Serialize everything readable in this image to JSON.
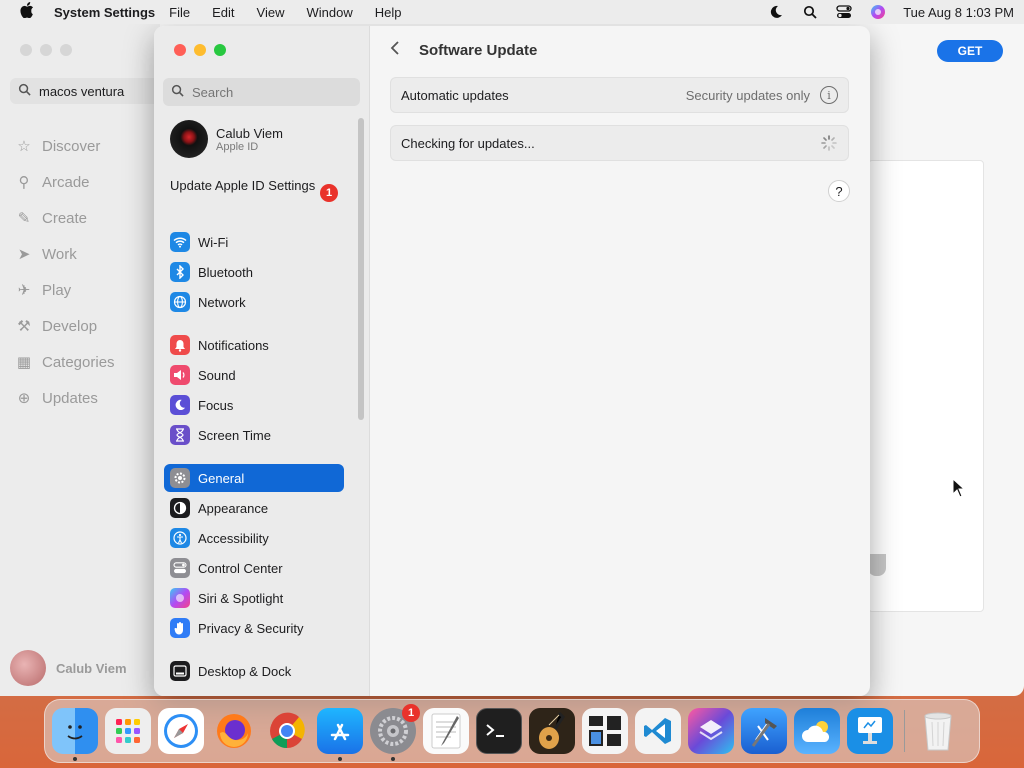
{
  "menubar": {
    "app_name": "System Settings",
    "items": [
      "File",
      "Edit",
      "View",
      "Window",
      "Help"
    ],
    "clock": "Tue Aug 8  1:03 PM"
  },
  "app_store": {
    "search_value": "macos ventura",
    "nav": [
      {
        "label": "Discover",
        "icon": "star-icon"
      },
      {
        "label": "Arcade",
        "icon": "arcade-icon"
      },
      {
        "label": "Create",
        "icon": "brush-icon"
      },
      {
        "label": "Work",
        "icon": "paperplane-icon"
      },
      {
        "label": "Play",
        "icon": "rocket-icon"
      },
      {
        "label": "Develop",
        "icon": "hammer-icon"
      },
      {
        "label": "Categories",
        "icon": "grid-icon"
      },
      {
        "label": "Updates",
        "icon": "download-icon"
      }
    ],
    "user": "Calub Viem",
    "get_label": "GET"
  },
  "settings": {
    "search_placeholder": "Search",
    "profile": {
      "name": "Calub Viem",
      "sub": "Apple ID"
    },
    "update_apple_id": "Update Apple ID Settings",
    "update_badge": "1",
    "items": [
      {
        "label": "Wi-Fi",
        "color": "#1e88e5",
        "glyph": "📶"
      },
      {
        "label": "Bluetooth",
        "color": "#1e88e5",
        "glyph": "ᛒ"
      },
      {
        "label": "Network",
        "color": "#1e88e5",
        "glyph": "🌐"
      },
      {
        "label": "Notifications",
        "color": "#ef4b4b",
        "glyph": "🔔"
      },
      {
        "label": "Sound",
        "color": "#ef4b6e",
        "glyph": "🔊"
      },
      {
        "label": "Focus",
        "color": "#5b4fd6",
        "glyph": "☾"
      },
      {
        "label": "Screen Time",
        "color": "#6a4fc9",
        "glyph": "⌛"
      },
      {
        "label": "General",
        "color": "#8e8e93",
        "glyph": "⚙"
      },
      {
        "label": "Appearance",
        "color": "#1c1c1e",
        "glyph": "◐"
      },
      {
        "label": "Accessibility",
        "color": "#1e88e5",
        "glyph": "♿"
      },
      {
        "label": "Control Center",
        "color": "#8e8e93",
        "glyph": "▤"
      },
      {
        "label": "Siri & Spotlight",
        "color": "#5b3fbf",
        "glyph": "◉"
      },
      {
        "label": "Privacy & Security",
        "color": "#2f7cf6",
        "glyph": "✋"
      },
      {
        "label": "Desktop & Dock",
        "color": "#1c1c1e",
        "glyph": "▭"
      }
    ],
    "page_title": "Software Update",
    "auto_updates_label": "Automatic updates",
    "auto_updates_value": "Security updates only",
    "checking_label": "Checking for updates...",
    "help_label": "?"
  },
  "dock": {
    "apps": [
      {
        "name": "finder-icon",
        "color": "#2f8ff0",
        "running": true
      },
      {
        "name": "launchpad-icon",
        "color": "#f0f0f0"
      },
      {
        "name": "safari-icon",
        "color": "#2d8ff5"
      },
      {
        "name": "firefox-icon",
        "color": "#ff7a1a"
      },
      {
        "name": "chrome-icon",
        "color": "#f2f2f2"
      },
      {
        "name": "app-store-icon",
        "color": "#1b8ff0",
        "running": true
      },
      {
        "name": "system-settings-icon",
        "color": "#7d7d82",
        "running": true,
        "badge": "1"
      },
      {
        "name": "textedit-icon",
        "color": "#f7f7f7"
      },
      {
        "name": "terminal-icon",
        "color": "#1f1f1f"
      },
      {
        "name": "garageband-icon",
        "color": "#3a2a1a"
      },
      {
        "name": "window-manager-icon",
        "color": "#f2f2f2"
      },
      {
        "name": "vscode-icon",
        "color": "#f0f0f0"
      },
      {
        "name": "shortcuts-icon",
        "color": "#6a4ad8"
      },
      {
        "name": "xcode-icon",
        "color": "#2f7cf6"
      },
      {
        "name": "weather-icon",
        "color": "#2b8ce0"
      },
      {
        "name": "keynote-icon",
        "color": "#1a8fe6"
      }
    ]
  }
}
